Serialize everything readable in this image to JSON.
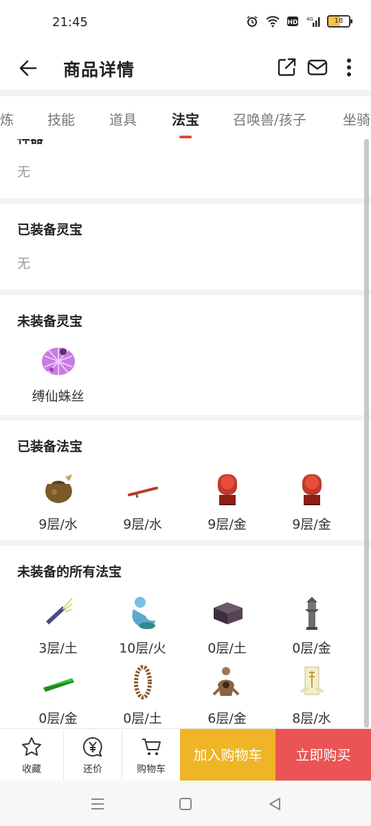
{
  "status_bar": {
    "time": "21:45",
    "battery": "18"
  },
  "app_bar": {
    "title": "商品详情"
  },
  "tabs": [
    {
      "label": "炼"
    },
    {
      "label": "技能"
    },
    {
      "label": "道具"
    },
    {
      "label": "法宝",
      "active": true
    },
    {
      "label": "召唤兽/孩子"
    },
    {
      "label": "坐骑"
    }
  ],
  "sections": {
    "partial": {
      "title": "神器",
      "value": "无"
    },
    "equipped_lingbao": {
      "title": "已装备灵宝",
      "value": "无"
    },
    "unequipped_lingbao": {
      "title": "未装备灵宝",
      "items": [
        {
          "label": "缚仙蛛丝",
          "icon": "spider-silk-icon"
        }
      ]
    },
    "equipped_fabao": {
      "title": "已装备法宝",
      "items": [
        {
          "label": "9层/水",
          "icon": "bag-icon"
        },
        {
          "label": "9层/水",
          "icon": "sword-icon"
        },
        {
          "label": "9层/金",
          "icon": "drum-icon"
        },
        {
          "label": "9层/金",
          "icon": "drum-icon"
        }
      ]
    },
    "all_unequipped_fabao": {
      "title": "未装备的所有法宝",
      "items": [
        {
          "label": "3层/土",
          "icon": "brush-icon"
        },
        {
          "label": "10层/火",
          "icon": "genie-icon"
        },
        {
          "label": "0层/土",
          "icon": "box-icon"
        },
        {
          "label": "0层/金",
          "icon": "pagoda-icon"
        },
        {
          "label": "0层/金",
          "icon": "jade-bar-icon"
        },
        {
          "label": "0层/土",
          "icon": "bead-necklace-icon"
        },
        {
          "label": "6层/金",
          "icon": "monk-figure-icon"
        },
        {
          "label": "8层/水",
          "icon": "talisman-icon"
        }
      ]
    }
  },
  "bottom_bar": {
    "favorite": "收藏",
    "bargain": "还价",
    "cart": "购物车",
    "add_to_cart": "加入购物车",
    "buy_now": "立即购买"
  },
  "colors": {
    "accent_red": "#ea5454",
    "accent_yellow": "#efb526",
    "tab_indicator": "#e6453e"
  }
}
